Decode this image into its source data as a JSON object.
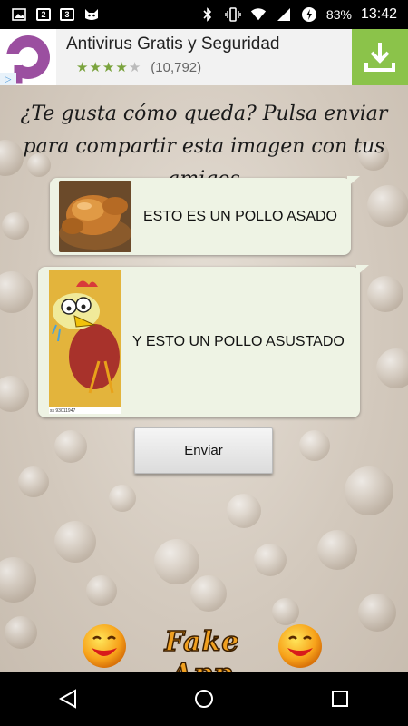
{
  "status_bar": {
    "notif_badge_1": "2",
    "notif_badge_2": "3",
    "battery_percent": "83%",
    "time": "13:42"
  },
  "ad": {
    "title": "Antivirus Gratis y Seguridad",
    "rating_stars": 4,
    "review_count": "(10,792)",
    "accent_color": "#8bc34a"
  },
  "main": {
    "headline": "¿Te gusta cómo queda? Pulsa enviar para compartir esta imagen con tus amigos",
    "messages": [
      {
        "text": "ESTO ES UN POLLO ASADO",
        "image": "roast-chicken"
      },
      {
        "text": "Y ESTO UN POLLO ASUSTADO",
        "image": "scared-chicken-cartoon",
        "image_caption": "ss 93011947"
      }
    ],
    "send_button": "Enviar",
    "logo_text": "Fake App"
  },
  "nav": {
    "icons": [
      "back-icon",
      "home-icon",
      "recents-icon"
    ]
  }
}
